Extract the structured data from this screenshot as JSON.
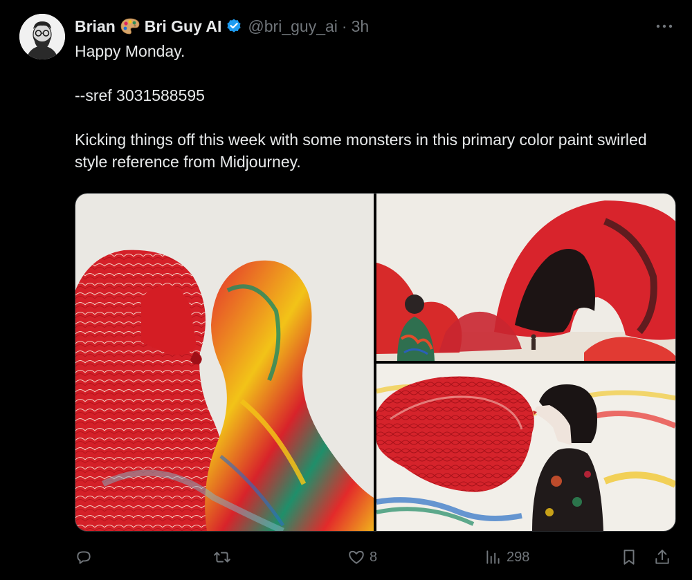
{
  "author": {
    "display_name": "Brian",
    "display_name_suffix": "Bri Guy AI",
    "handle": "@bri_guy_ai",
    "separator": "·",
    "time": "3h",
    "verified": true,
    "avatar_icon": "bearded-man-avatar",
    "name_emoji": "artist-palette"
  },
  "tweet": {
    "lines": [
      "Happy Monday.",
      "",
      "--sref 3031588595",
      "",
      "Kicking things off this week with some monsters in this primary color paint swirled style reference from Midjourney."
    ]
  },
  "media": {
    "count": 3
  },
  "actions": {
    "reply": {
      "icon": "reply-icon",
      "count": ""
    },
    "repost": {
      "icon": "repost-icon",
      "count": ""
    },
    "like": {
      "icon": "heart-icon",
      "count": "8"
    },
    "views": {
      "icon": "views-icon",
      "count": "298"
    },
    "bookmark": {
      "icon": "bookmark-icon"
    },
    "share": {
      "icon": "share-icon"
    }
  },
  "colors": {
    "background": "#000000",
    "text": "#e7e9ea",
    "secondary_text": "#71767b",
    "verified_blue": "#1d9bf0",
    "border": "#2f3336"
  }
}
